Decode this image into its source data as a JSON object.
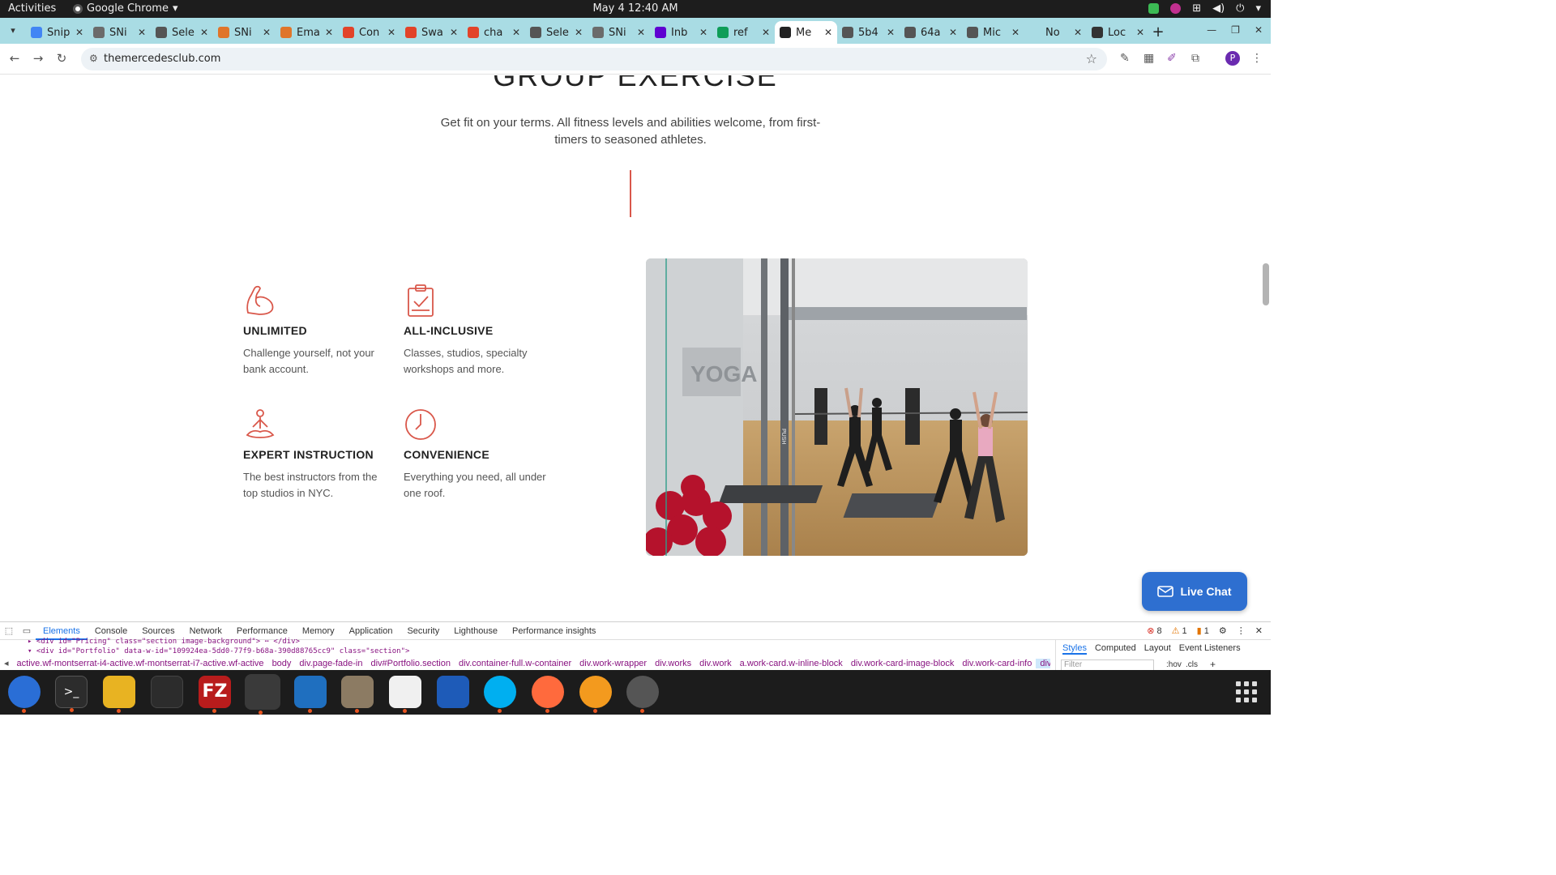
{
  "topbar": {
    "activities": "Activities",
    "app_name": "Google Chrome",
    "clock": "May 4  12:40 AM"
  },
  "tabs": [
    {
      "title": "Snip",
      "color": "#4285f4"
    },
    {
      "title": "SNi",
      "color": "#6b6b6b"
    },
    {
      "title": "Sele",
      "color": "#555555"
    },
    {
      "title": "SNi",
      "color": "#e0752a"
    },
    {
      "title": "Ema",
      "color": "#e0752a"
    },
    {
      "title": "Con",
      "color": "#e24329"
    },
    {
      "title": "Swa",
      "color": "#e24329"
    },
    {
      "title": "cha",
      "color": "#e24329"
    },
    {
      "title": "Sele",
      "color": "#555555"
    },
    {
      "title": "SNi",
      "color": "#6b6b6b"
    },
    {
      "title": "Inb",
      "color": "#5f01d1"
    },
    {
      "title": "ref",
      "color": "#0f9d58"
    },
    {
      "title": "Me",
      "color": "#222222",
      "active": true
    },
    {
      "title": "5b4",
      "color": "#555555"
    },
    {
      "title": "64a",
      "color": "#555555"
    },
    {
      "title": "Mic",
      "color": "#555555"
    },
    {
      "title": "No",
      "color": "#a9dce4"
    },
    {
      "title": "Loc",
      "color": "#333333"
    }
  ],
  "address": {
    "url": "themercedesclub.com"
  },
  "page": {
    "section_title": "GROUP EXERCISE",
    "lead": "Get fit on your terms. All fitness levels and abilities welcome, from first-timers to seasoned athletes.",
    "features": [
      {
        "icon": "flexed-arm-icon",
        "title": "UNLIMITED",
        "desc": "Challenge yourself, not your bank account."
      },
      {
        "icon": "clipboard-check-icon",
        "title": "ALL-INCLUSIVE",
        "desc": "Classes, studios, specialty workshops and more."
      },
      {
        "icon": "meditation-icon",
        "title": "EXPERT INSTRUCTION",
        "desc": "The best instructors from the top studios in NYC."
      },
      {
        "icon": "clock-icon",
        "title": "CONVENIENCE",
        "desc": "Everything you need, all under one roof."
      }
    ],
    "photo_sign": "YOGA",
    "door_label": "PUSH",
    "live_chat": "Live Chat",
    "accent_color": "#d9574a"
  },
  "devtools": {
    "tabs": [
      "Elements",
      "Console",
      "Sources",
      "Network",
      "Performance",
      "Memory",
      "Application",
      "Security",
      "Lighthouse",
      "Performance insights"
    ],
    "errors": "8",
    "warnings": "1",
    "issues": "1",
    "dom_line_1": "▸ <div id=\"Pricing\" class=\"section image-background\"> ⋯ </div>",
    "dom_line_2": "▾ <div id=\"Portfolio\" data-w-id=\"109924ea-5dd0-77f9-b68a-390d88765cc9\" class=\"section\">",
    "breadcrumbs": [
      "active.wf-montserrat-i4-active.wf-montserrat-i7-active.wf-active",
      "body",
      "div.page-fade-in",
      "div#Portfolio.section",
      "div.container-full.w-container",
      "div.work-wrapper",
      "div.works",
      "div.work",
      "a.work-card.w-inline-block",
      "div.work-card-image-block",
      "div.work-card-info",
      "div.button-div"
    ],
    "styles_tabs": [
      "Styles",
      "Computed",
      "Layout",
      "Event Listeners"
    ],
    "filter_placeholder": "Filter",
    "hov": ":hov",
    "cls": ".cls"
  }
}
